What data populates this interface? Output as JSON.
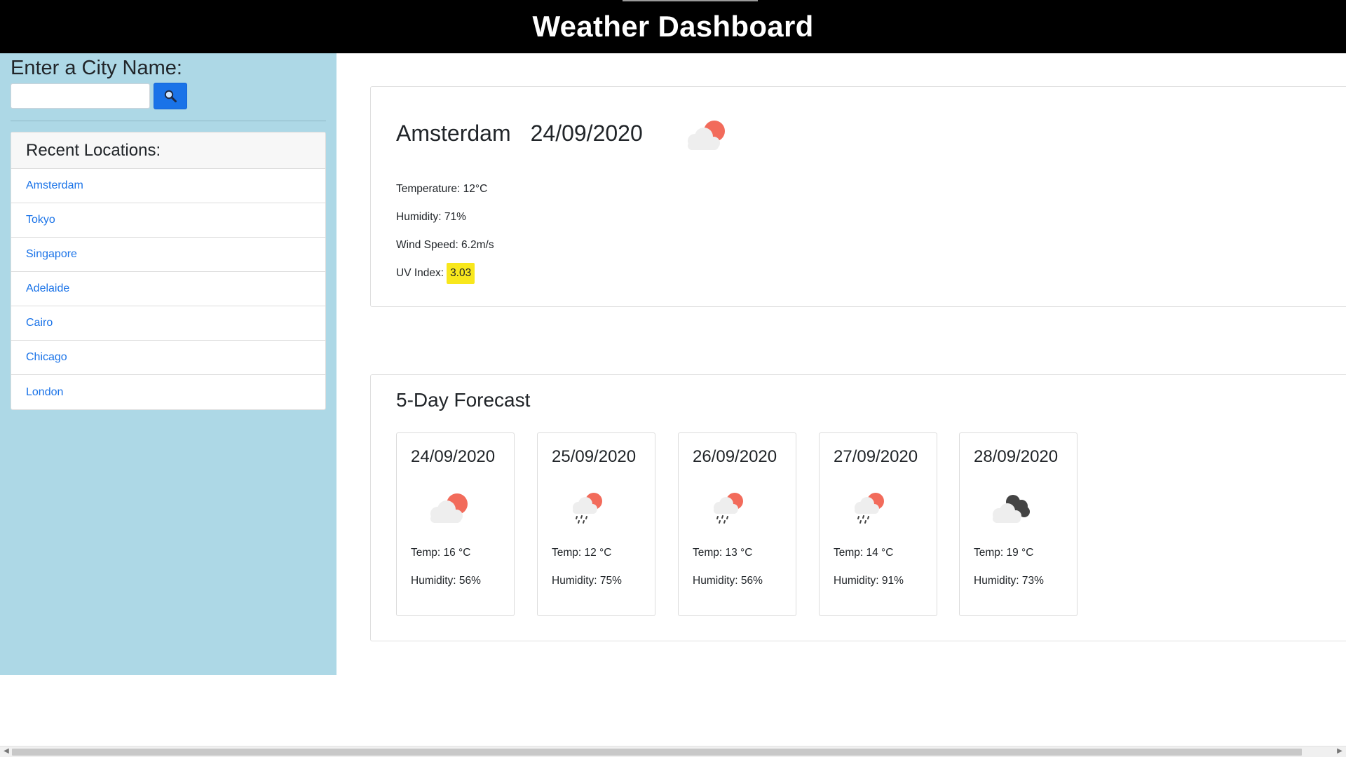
{
  "header": {
    "title": "Weather Dashboard"
  },
  "sidebar": {
    "search_label": "Enter a City Name:",
    "search_value": "",
    "search_icon": "magnifier-icon",
    "recent_title": "Recent Locations:",
    "recent_locations": [
      "Amsterdam",
      "Tokyo",
      "Singapore",
      "Adelaide",
      "Cairo",
      "Chicago",
      "London"
    ]
  },
  "current": {
    "city": "Amsterdam",
    "date": "24/09/2020",
    "icon": "partly-cloudy-icon",
    "temperature": "Temperature: 12°C",
    "humidity": "Humidity: 71%",
    "wind": "Wind Speed: 6.2m/s",
    "uv_label": "UV Index:",
    "uv_value": "3.03"
  },
  "forecast": {
    "title": "5-Day Forecast",
    "days": [
      {
        "date": "24/09/2020",
        "icon": "partly-cloudy-icon",
        "temp": "Temp: 16 °C",
        "humidity": "Humidity: 56%"
      },
      {
        "date": "25/09/2020",
        "icon": "rain-sun-icon",
        "temp": "Temp: 12 °C",
        "humidity": "Humidity: 75%"
      },
      {
        "date": "26/09/2020",
        "icon": "rain-sun-icon",
        "temp": "Temp: 13 °C",
        "humidity": "Humidity: 56%"
      },
      {
        "date": "27/09/2020",
        "icon": "rain-sun-icon",
        "temp": "Temp: 14 °C",
        "humidity": "Humidity: 91%"
      },
      {
        "date": "28/09/2020",
        "icon": "overcast-clouds-icon",
        "temp": "Temp: 19 °C",
        "humidity": "Humidity: 73%"
      }
    ]
  },
  "colors": {
    "header_bg": "#000000",
    "sidebar_bg": "#add8e6",
    "link": "#1a73e8",
    "uv_highlight": "#f8e71c",
    "sun": "#f26b5b"
  }
}
